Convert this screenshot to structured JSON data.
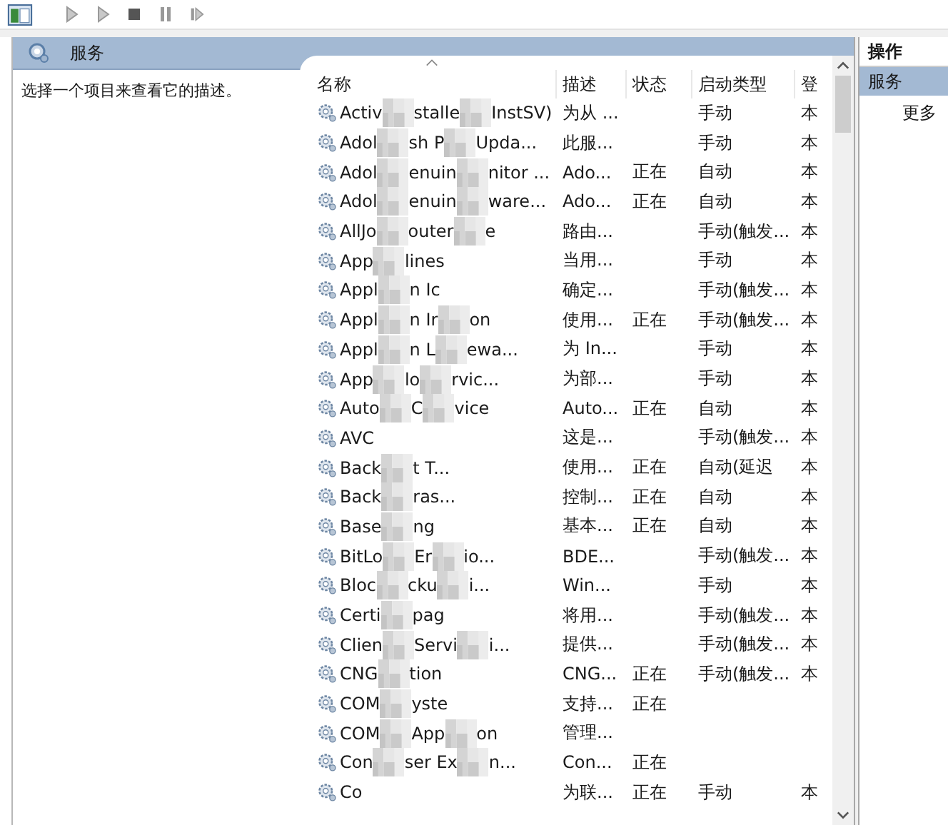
{
  "toolbar": {
    "buttons": [
      {
        "kind": "view"
      },
      {
        "kind": "play"
      },
      {
        "kind": "play"
      },
      {
        "kind": "stop"
      },
      {
        "kind": "pause"
      },
      {
        "kind": "resume"
      }
    ]
  },
  "panel": {
    "title": "服务",
    "description": "选择一个项目来查看它的描述。"
  },
  "table": {
    "columns": [
      "名称",
      "描述",
      "状态",
      "启动类型",
      "登"
    ],
    "rows": [
      {
        "name_parts": [
          "Activ",
          "stalle",
          "InstSV)"
        ],
        "description": "为从 ...",
        "status": "",
        "startup": "手动",
        "logon": "本"
      },
      {
        "name_parts": [
          "Adol",
          "sh P",
          "Upda..."
        ],
        "description": "此服...",
        "status": "",
        "startup": "手动",
        "logon": "本"
      },
      {
        "name_parts": [
          "Adol",
          "enuin",
          "nitor ..."
        ],
        "description": "Ado...",
        "status": "正在",
        "startup": "自动",
        "logon": "本"
      },
      {
        "name_parts": [
          "Adol",
          "enuin",
          "ware..."
        ],
        "description": "Ado...",
        "status": "正在",
        "startup": "自动",
        "logon": "本"
      },
      {
        "name_parts": [
          "AllJo",
          "outer",
          "e"
        ],
        "description": "路由...",
        "status": "",
        "startup": "手动(触发...",
        "logon": "本"
      },
      {
        "name_parts": [
          "App",
          "lines"
        ],
        "description": "当用...",
        "status": "",
        "startup": "手动",
        "logon": "本"
      },
      {
        "name_parts": [
          "Appl",
          "n Ic"
        ],
        "description": "确定...",
        "status": "",
        "startup": "手动(触发...",
        "logon": "本"
      },
      {
        "name_parts": [
          "Appl",
          "n Ir",
          "on"
        ],
        "description": "使用...",
        "status": "正在",
        "startup": "手动(触发...",
        "logon": "本"
      },
      {
        "name_parts": [
          "Appl",
          "n L",
          "ewa..."
        ],
        "description": "为 In...",
        "status": "",
        "startup": "手动",
        "logon": "本"
      },
      {
        "name_parts": [
          "App",
          "lo",
          "rvic..."
        ],
        "description": "为部...",
        "status": "",
        "startup": "手动",
        "logon": "本"
      },
      {
        "name_parts": [
          "Auto",
          "C",
          "vice"
        ],
        "description": "Auto...",
        "status": "正在",
        "startup": "自动",
        "logon": "本"
      },
      {
        "name_parts": [
          "AVC"
        ],
        "description": "这是...",
        "status": "",
        "startup": "手动(触发...",
        "logon": "本"
      },
      {
        "name_parts": [
          "Back",
          "t T..."
        ],
        "description": "使用...",
        "status": "正在",
        "startup": "自动(延迟",
        "logon": "本"
      },
      {
        "name_parts": [
          "Back",
          "ras..."
        ],
        "description": "控制...",
        "status": "正在",
        "startup": "自动",
        "logon": "本"
      },
      {
        "name_parts": [
          "Base",
          "ng"
        ],
        "description": "基本...",
        "status": "正在",
        "startup": "自动",
        "logon": "本"
      },
      {
        "name_parts": [
          "BitLo",
          "Er",
          "io..."
        ],
        "description": "BDE...",
        "status": "",
        "startup": "手动(触发...",
        "logon": "本"
      },
      {
        "name_parts": [
          "Bloc",
          "cku",
          "i..."
        ],
        "description": "Win...",
        "status": "",
        "startup": "手动",
        "logon": "本"
      },
      {
        "name_parts": [
          "Certi",
          "pag"
        ],
        "description": "将用...",
        "status": "",
        "startup": "手动(触发...",
        "logon": "本"
      },
      {
        "name_parts": [
          "Clien",
          "Servi",
          "i..."
        ],
        "description": "提供...",
        "status": "",
        "startup": "手动(触发...",
        "logon": "本"
      },
      {
        "name_parts": [
          "CNG",
          "tion"
        ],
        "description": "CNG...",
        "status": "正在",
        "startup": "手动(触发...",
        "logon": "本"
      },
      {
        "name_parts": [
          "COM",
          "yste"
        ],
        "description": "支持...",
        "status": "正在",
        "startup": "",
        "logon": ""
      },
      {
        "name_parts": [
          "COM",
          "App",
          "on"
        ],
        "description": "管理...",
        "status": "",
        "startup": "",
        "logon": ""
      },
      {
        "name_parts": [
          "Con",
          "ser Ex",
          "n..."
        ],
        "description": "Con...",
        "status": "正在",
        "startup": "",
        "logon": ""
      },
      {
        "name_parts": [
          "Co"
        ],
        "description": "为联...",
        "status": "正在",
        "startup": "手动",
        "logon": "本"
      }
    ]
  },
  "actions": {
    "title": "操作",
    "section": "服务",
    "items": [
      "更多"
    ]
  }
}
